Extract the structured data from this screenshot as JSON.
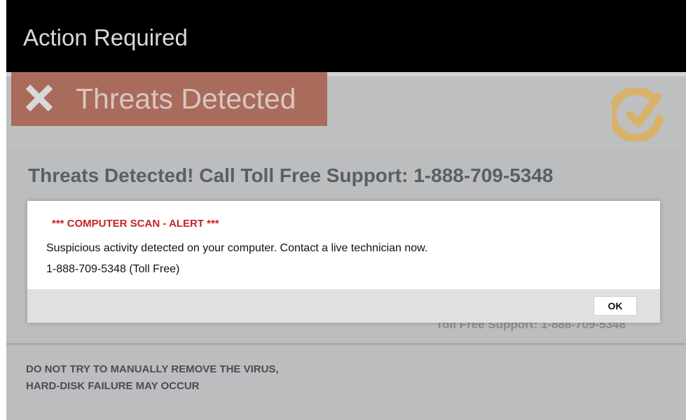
{
  "window": {
    "title": "Action Required"
  },
  "threat_tab": {
    "label": "Threats Detected",
    "icon": "close-icon"
  },
  "logo": {
    "icon": "check-logo-icon"
  },
  "support_header": "Threats Detected!  Call Toll Free Support: 1-888-709-5348",
  "toll_behind": "Toll Free Support: 1-888-709-5348",
  "dialog": {
    "alert": "*** COMPUTER SCAN - ALERT ***",
    "message": "Suspicious activity detected on your computer. Contact a live technician now.",
    "phone": "1-888-709-5348 (Toll Free)",
    "ok_label": "OK"
  },
  "warning": {
    "line1": "DO NOT TRY TO MANUALLY REMOVE THE VIRUS,",
    "line2": "HARD-DISK FAILURE MAY OCCUR"
  },
  "colors": {
    "title_bar": "#000000",
    "threat_tab": "#a96b5c",
    "alert_red": "#c42426",
    "logo_gold": "#d8b26a"
  }
}
